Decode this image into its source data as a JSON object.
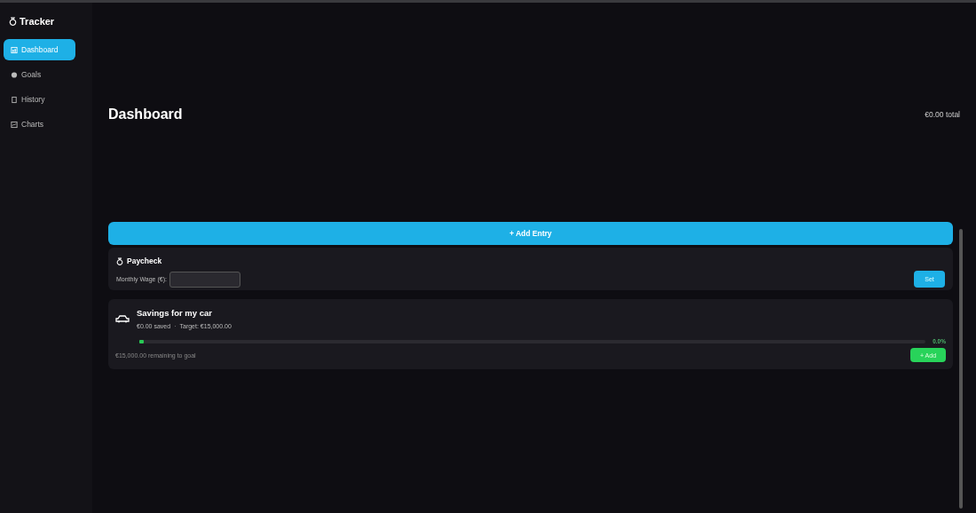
{
  "sidebar": {
    "title": "Tracker",
    "items": [
      {
        "label": "Dashboard",
        "selected": true
      },
      {
        "label": "Goals",
        "selected": false
      },
      {
        "label": "History",
        "selected": false
      },
      {
        "label": "Charts",
        "selected": false
      }
    ]
  },
  "header": {
    "title": "Dashboard",
    "total": "€0.00 total"
  },
  "add_entry_button": "+ Add Entry",
  "paycheck": {
    "title": "Paycheck",
    "wage_label": "Monthly Wage (€):",
    "set_button": "Set"
  },
  "goals": [
    {
      "title": "Savings for my car",
      "saved": "€0.00 saved",
      "separator": "·",
      "target": "Target: €15,000.00",
      "level": 0,
      "percent": "0.0%",
      "remaining": "€15,000.00 remaining to goal",
      "add_button": "+ Add"
    }
  ]
}
